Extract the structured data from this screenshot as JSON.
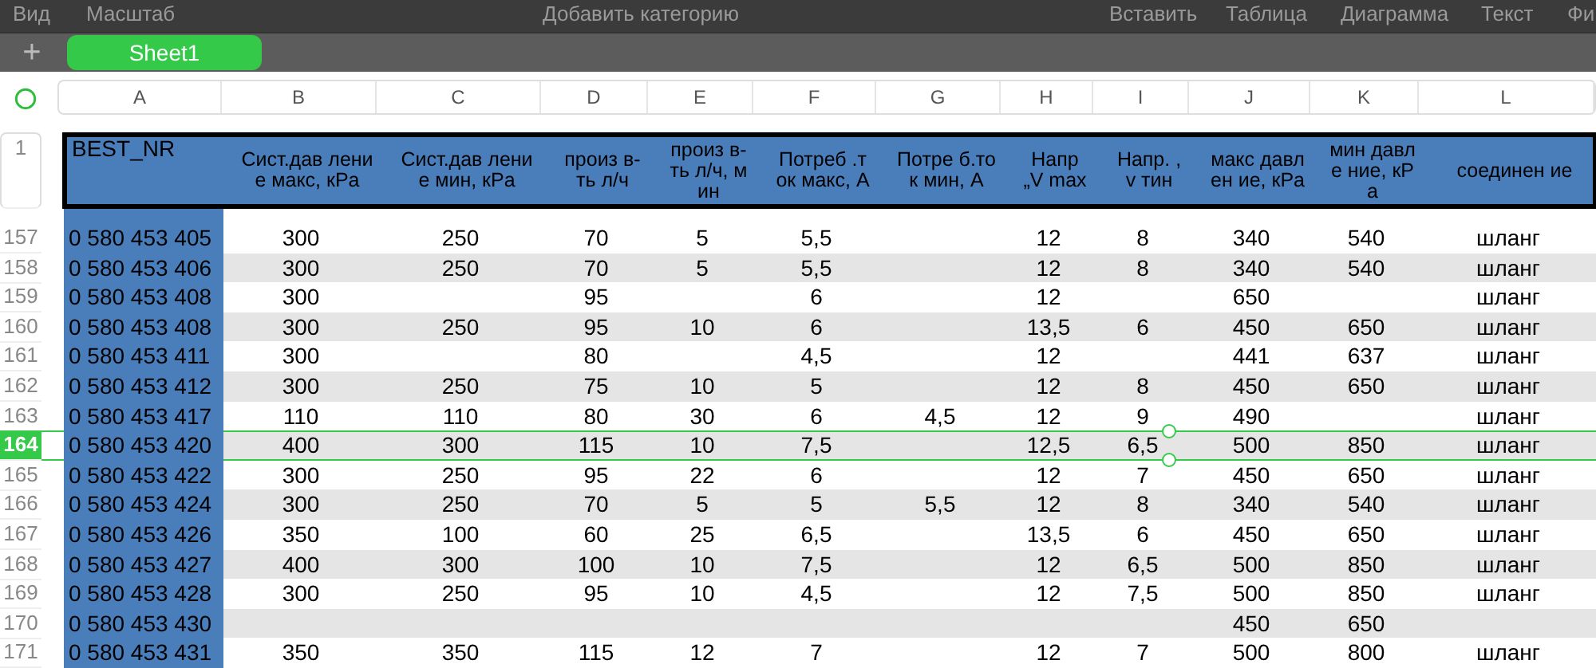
{
  "menu_bar": {
    "items": [
      "Вид",
      "Масштаб",
      "Добавить категорию",
      "Вставить",
      "Таблица",
      "Диаграмма",
      "Текст",
      "Фи"
    ]
  },
  "sheet_tabs": {
    "add_button": "+",
    "tabs": [
      {
        "label": "Sheet1",
        "selected": true
      }
    ]
  },
  "table": {
    "columns": [
      "A",
      "B",
      "C",
      "D",
      "E",
      "F",
      "G",
      "H",
      "I",
      "J",
      "K",
      "L"
    ],
    "header_row": {
      "number": "1",
      "cells": [
        "BEST_NR",
        "Сист.дав ление макс, кPa",
        "Сист.дав ление мин, кPa",
        "произ в-ть л/ч",
        "произ в-ть л/ч, мин",
        "Потреб .т ок макс, А",
        "Потре б.ток мин, А",
        "Напр „V max",
        "Напр. , v тин",
        "макс давлен ие, кPa",
        "мин давле ние, кPa",
        "соединен ие"
      ]
    },
    "rows": [
      {
        "number": "157",
        "selected": false,
        "cells": [
          "0 580 453 405",
          "300",
          "250",
          "70",
          "5",
          "5,5",
          null,
          "12",
          "8",
          "340",
          "540",
          "шланг"
        ]
      },
      {
        "number": "158",
        "selected": false,
        "cells": [
          "0 580 453 406",
          "300",
          "250",
          "70",
          "5",
          "5,5",
          null,
          "12",
          "8",
          "340",
          "540",
          "шланг"
        ]
      },
      {
        "number": "159",
        "selected": false,
        "cells": [
          "0 580 453 408",
          "300",
          null,
          "95",
          null,
          "6",
          null,
          "12",
          null,
          "650",
          null,
          "шланг"
        ]
      },
      {
        "number": "160",
        "selected": false,
        "cells": [
          "0 580 453 408",
          "300",
          "250",
          "95",
          "10",
          "6",
          null,
          "13,5",
          "6",
          "450",
          "650",
          "шланг"
        ]
      },
      {
        "number": "161",
        "selected": false,
        "cells": [
          "0 580 453 411",
          "300",
          null,
          "80",
          null,
          "4,5",
          null,
          "12",
          null,
          "441",
          "637",
          "шланг"
        ]
      },
      {
        "number": "162",
        "selected": false,
        "cells": [
          "0 580 453 412",
          "300",
          "250",
          "75",
          "10",
          "5",
          null,
          "12",
          "8",
          "450",
          "650",
          "шланг"
        ]
      },
      {
        "number": "163",
        "selected": false,
        "cells": [
          "0 580 453 417",
          "110",
          "110",
          "80",
          "30",
          "6",
          "4,5",
          "12",
          "9",
          "490",
          null,
          "шланг"
        ]
      },
      {
        "number": "164",
        "selected": true,
        "cells": [
          "0 580 453 420",
          "400",
          "300",
          "115",
          "10",
          "7,5",
          null,
          "12,5",
          "6,5",
          "500",
          "850",
          "шланг"
        ]
      },
      {
        "number": "165",
        "selected": false,
        "cells": [
          "0 580 453 422",
          "300",
          "250",
          "95",
          "22",
          "6",
          null,
          "12",
          "7",
          "450",
          "650",
          "шланг"
        ]
      },
      {
        "number": "166",
        "selected": false,
        "cells": [
          "0 580 453 424",
          "300",
          "250",
          "70",
          "5",
          "5",
          "5,5",
          "12",
          "8",
          "340",
          "540",
          "шланг"
        ]
      },
      {
        "number": "167",
        "selected": false,
        "cells": [
          "0 580 453 426",
          "350",
          "100",
          "60",
          "25",
          "6,5",
          null,
          "13,5",
          "6",
          "450",
          "650",
          "шланг"
        ]
      },
      {
        "number": "168",
        "selected": false,
        "cells": [
          "0 580 453 427",
          "400",
          "300",
          "100",
          "10",
          "7,5",
          null,
          "12",
          "6,5",
          "500",
          "850",
          "шланг"
        ]
      },
      {
        "number": "169",
        "selected": false,
        "cells": [
          "0 580 453 428",
          "300",
          "250",
          "95",
          "10",
          "4,5",
          null,
          "12",
          "7,5",
          "500",
          "850",
          "шланг"
        ]
      },
      {
        "number": "170",
        "selected": false,
        "cells": [
          "0 580 453 430",
          null,
          null,
          null,
          null,
          null,
          null,
          null,
          null,
          "450",
          "650",
          null
        ]
      },
      {
        "number": "171",
        "selected": false,
        "cells": [
          "0 580 453 431",
          "350",
          "350",
          "115",
          "12",
          "7",
          null,
          "12",
          "7",
          "500",
          "800",
          "шланг"
        ]
      }
    ]
  }
}
